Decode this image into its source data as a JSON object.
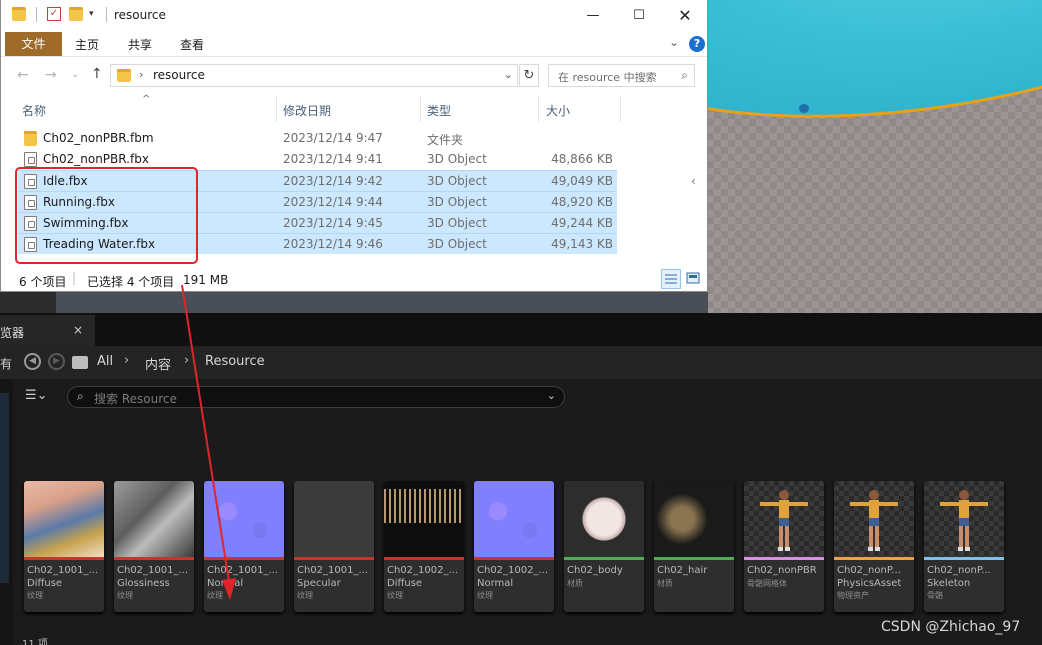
{
  "explorer": {
    "title": "resource",
    "ribbon": {
      "file": "文件",
      "tabs": [
        "主页",
        "共享",
        "查看"
      ],
      "help": "?"
    },
    "address": {
      "path": "resource",
      "search_placeholder": "在 resource 中搜索"
    },
    "columns": {
      "name": "名称",
      "date": "修改日期",
      "type": "类型",
      "size": "大小"
    },
    "files": [
      {
        "name": "Ch02_nonPBR.fbm",
        "date": "2023/12/14 9:47",
        "type": "文件夹",
        "size": "",
        "icon": "folder-icon",
        "selected": false
      },
      {
        "name": "Ch02_nonPBR.fbx",
        "date": "2023/12/14 9:41",
        "type": "3D Object",
        "size": "48,866 KB",
        "icon": "3d-object-icon",
        "selected": false
      },
      {
        "name": "Idle.fbx",
        "date": "2023/12/14 9:42",
        "type": "3D Object",
        "size": "49,049 KB",
        "icon": "3d-object-icon",
        "selected": true
      },
      {
        "name": "Running.fbx",
        "date": "2023/12/14 9:44",
        "type": "3D Object",
        "size": "48,920 KB",
        "icon": "3d-object-icon",
        "selected": true
      },
      {
        "name": "Swimming.fbx",
        "date": "2023/12/14 9:45",
        "type": "3D Object",
        "size": "49,244 KB",
        "icon": "3d-object-icon",
        "selected": true
      },
      {
        "name": "Treading Water.fbx",
        "date": "2023/12/14 9:46",
        "type": "3D Object",
        "size": "49,143 KB",
        "icon": "3d-object-icon",
        "selected": true
      }
    ],
    "status": {
      "count": "6 个项目",
      "selected": "已选择 4 个项目",
      "size": "191 MB"
    }
  },
  "content_browser": {
    "tab_title": "览器",
    "tab_close": "×",
    "left_edge_label": "有",
    "breadcrumb": [
      "All",
      "内容",
      "Resource"
    ],
    "search_placeholder": "搜索 Resource",
    "assets": [
      {
        "name": "Ch02_1001_...",
        "sub": "Diffuse",
        "type": "纹理",
        "bar_color": "#c0392b",
        "thumb": "diffuse-texture"
      },
      {
        "name": "Ch02_1001_...",
        "sub": "Glossiness",
        "type": "纹理",
        "bar_color": "#c0392b",
        "thumb": "glossiness-texture"
      },
      {
        "name": "Ch02_1001_...",
        "sub": "Normal",
        "type": "纹理",
        "bar_color": "#c0392b",
        "thumb": "normal-texture"
      },
      {
        "name": "Ch02_1001_...",
        "sub": "Specular",
        "type": "纹理",
        "bar_color": "#c0392b",
        "thumb": "specular-texture"
      },
      {
        "name": "Ch02_1002_...",
        "sub": "Diffuse",
        "type": "纹理",
        "bar_color": "#c0392b",
        "thumb": "hair-diffuse-texture"
      },
      {
        "name": "Ch02_1002_...",
        "sub": "Normal",
        "type": "纹理",
        "bar_color": "#c0392b",
        "thumb": "normal-texture"
      },
      {
        "name": "Ch02_body",
        "sub": "",
        "type": "材质",
        "bar_color": "#4caf50",
        "thumb": "material-sphere"
      },
      {
        "name": "Ch02_hair",
        "sub": "",
        "type": "材质",
        "bar_color": "#4caf50",
        "thumb": "hair-material"
      },
      {
        "name": "Ch02_nonPBR",
        "sub": "",
        "type": "骨骼网格体",
        "bar_color": "#d98ee8",
        "thumb": "character"
      },
      {
        "name": "Ch02_nonP...",
        "sub": "PhysicsAsset",
        "type": "物理资产",
        "bar_color": "#f0a04b",
        "thumb": "character"
      },
      {
        "name": "Ch02_nonP...",
        "sub": "Skeleton",
        "type": "骨骼",
        "bar_color": "#7ec0ee",
        "thumb": "character"
      }
    ],
    "item_count": "11 项"
  },
  "watermark": "CSDN @Zhichao_97",
  "colors": {
    "selection": "#cce8ff",
    "annotation_red": "#e0242c",
    "file_tab": "#9e6b29"
  }
}
